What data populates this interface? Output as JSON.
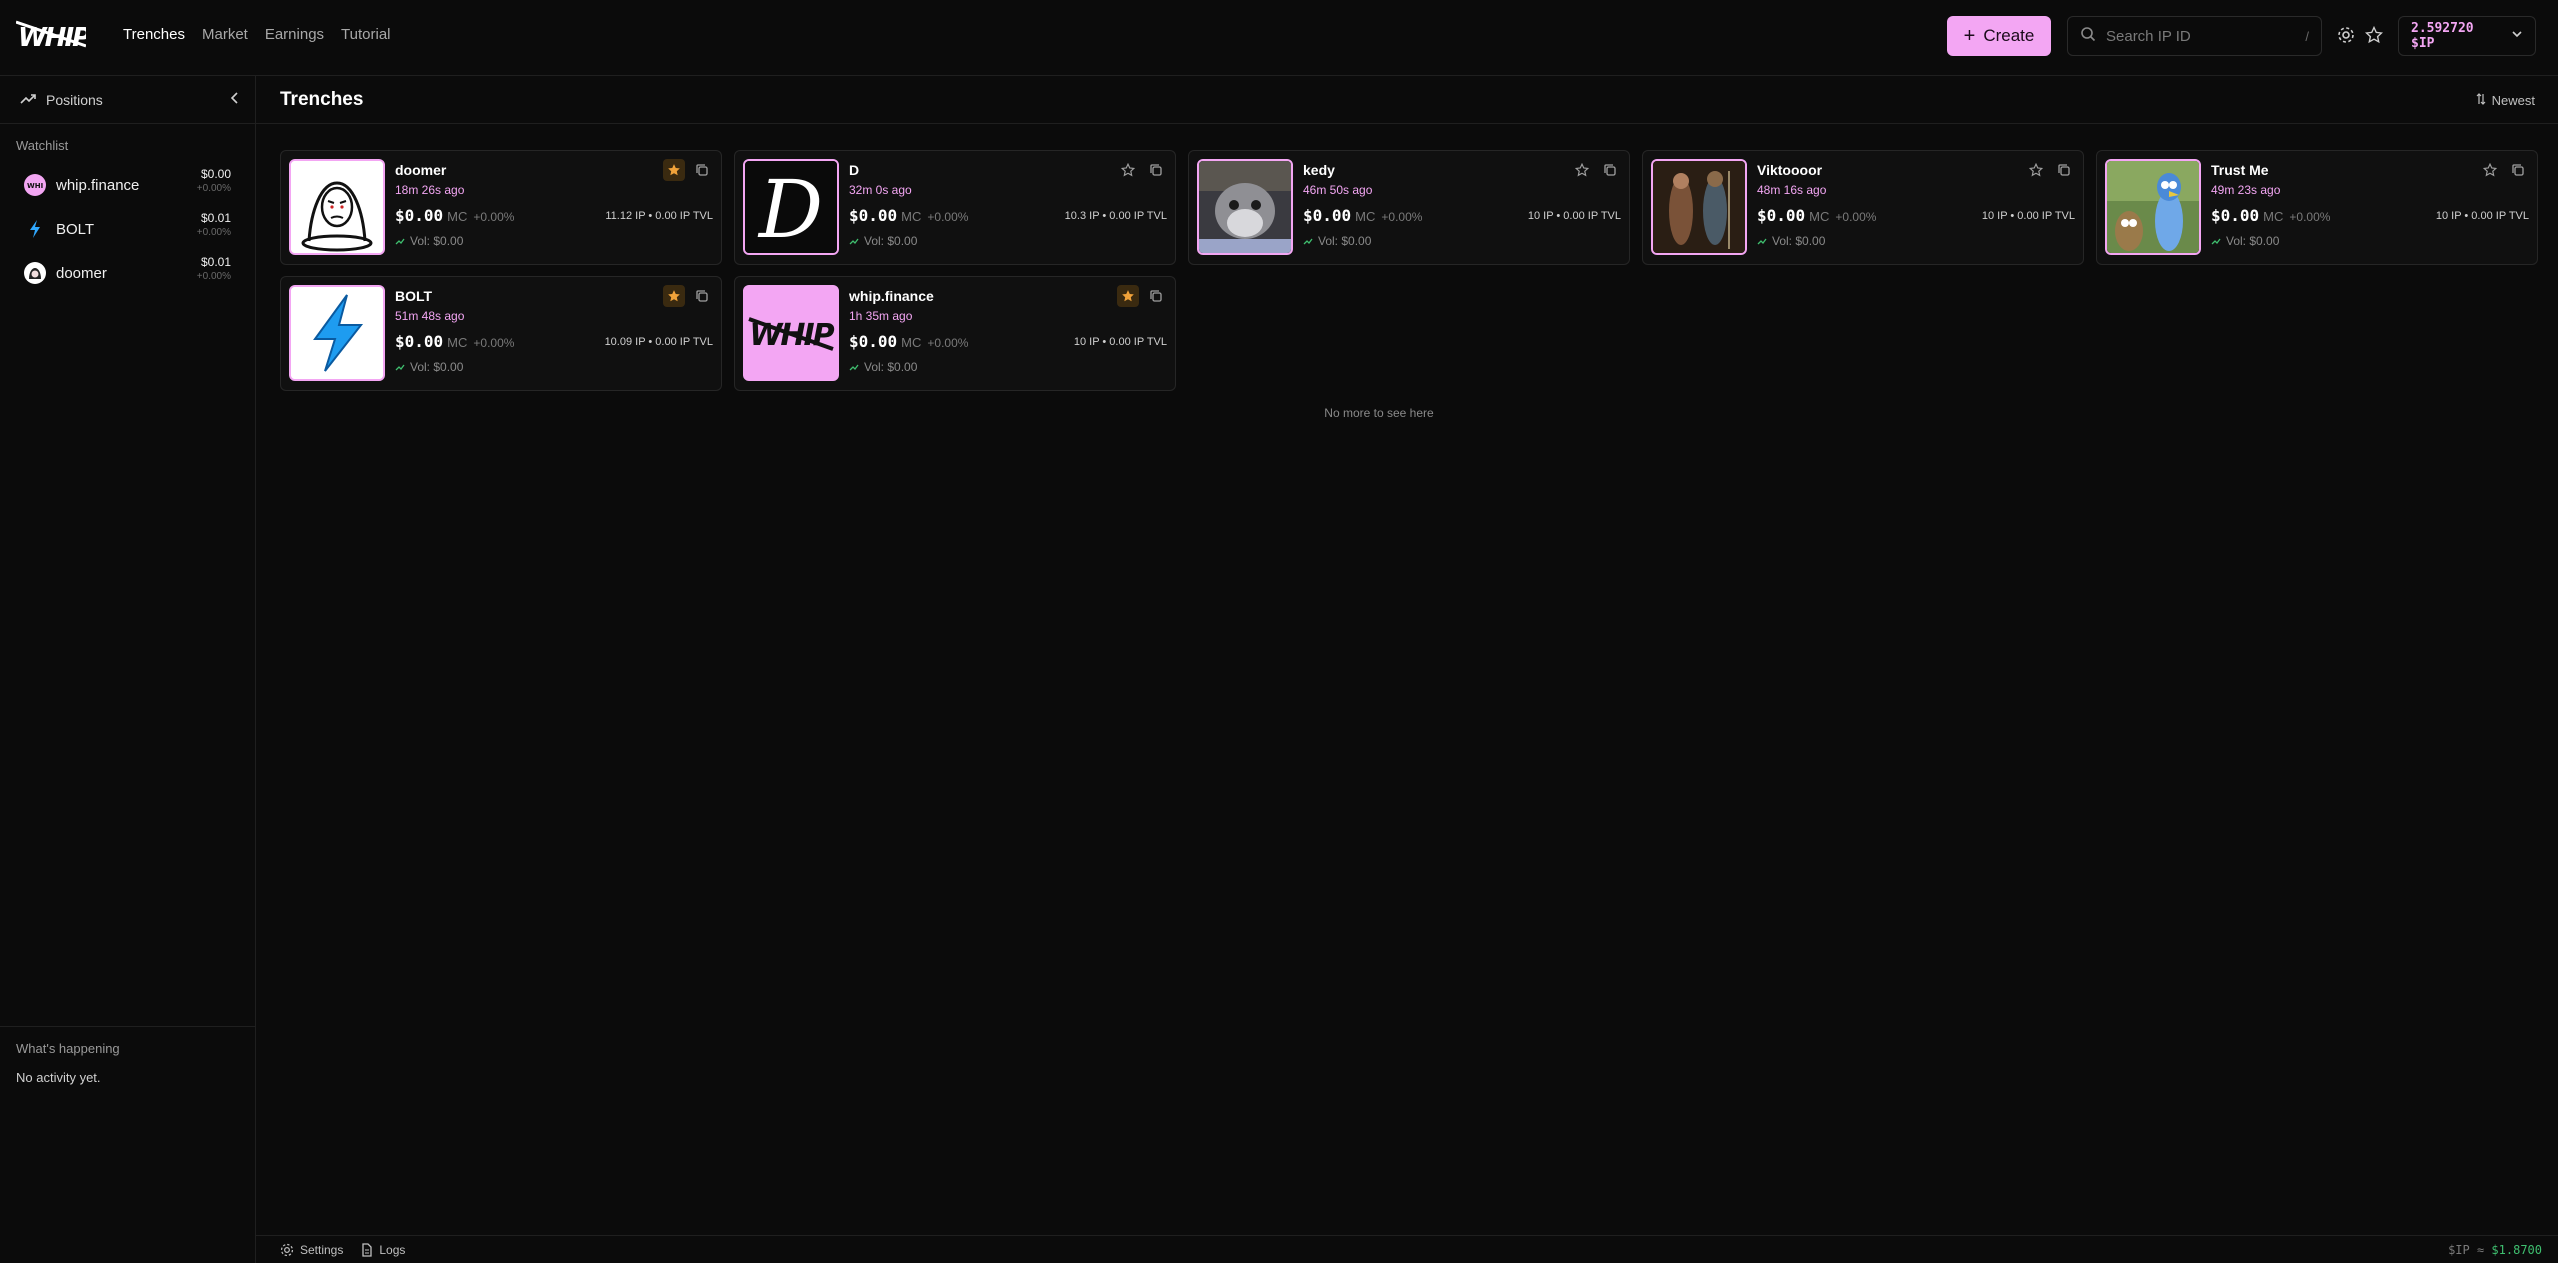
{
  "header": {
    "logo_text": "WHIP",
    "nav": [
      "Trenches",
      "Market",
      "Earnings",
      "Tutorial"
    ],
    "active_nav": "Trenches",
    "create_label": "Create",
    "search_placeholder": "Search IP ID",
    "search_shortcut": "/",
    "wallet_balance": "2.592720 $IP"
  },
  "sidebar": {
    "positions_label": "Positions",
    "watchlist_title": "Watchlist",
    "watchlist": [
      {
        "name": "whip.finance",
        "price": "$0.00",
        "change": "+0.00%"
      },
      {
        "name": "BOLT",
        "price": "$0.01",
        "change": "+0.00%"
      },
      {
        "name": "doomer",
        "price": "$0.01",
        "change": "+0.00%"
      }
    ],
    "happening_title": "What's happening",
    "happening_text": "No activity yet."
  },
  "main": {
    "title": "Trenches",
    "sort_label": "Newest",
    "empty_text": "No more to see here",
    "cards": [
      {
        "name": "doomer",
        "age": "18m 26s ago",
        "price": "$0.00",
        "mc": "MC",
        "change": "+0.00%",
        "tvl": "11.12 IP • 0.00 IP TVL",
        "vol": "Vol: $0.00",
        "starred": true
      },
      {
        "name": "D",
        "age": "32m 0s ago",
        "price": "$0.00",
        "mc": "MC",
        "change": "+0.00%",
        "tvl": "10.3 IP • 0.00 IP TVL",
        "vol": "Vol: $0.00",
        "starred": false
      },
      {
        "name": "kedy",
        "age": "46m 50s ago",
        "price": "$0.00",
        "mc": "MC",
        "change": "+0.00%",
        "tvl": "10 IP • 0.00 IP TVL",
        "vol": "Vol: $0.00",
        "starred": false
      },
      {
        "name": "Viktoooor",
        "age": "48m 16s ago",
        "price": "$0.00",
        "mc": "MC",
        "change": "+0.00%",
        "tvl": "10 IP • 0.00 IP TVL",
        "vol": "Vol: $0.00",
        "starred": false
      },
      {
        "name": "Trust Me",
        "age": "49m 23s ago",
        "price": "$0.00",
        "mc": "MC",
        "change": "+0.00%",
        "tvl": "10 IP • 0.00 IP TVL",
        "vol": "Vol: $0.00",
        "starred": false
      },
      {
        "name": "BOLT",
        "age": "51m 48s ago",
        "price": "$0.00",
        "mc": "MC",
        "change": "+0.00%",
        "tvl": "10.09 IP • 0.00 IP TVL",
        "vol": "Vol: $0.00",
        "starred": true
      },
      {
        "name": "whip.finance",
        "age": "1h 35m ago",
        "price": "$0.00",
        "mc": "MC",
        "change": "+0.00%",
        "tvl": "10 IP • 0.00 IP TVL",
        "vol": "Vol: $0.00",
        "starred": true
      }
    ]
  },
  "footer": {
    "settings_label": "Settings",
    "logs_label": "Logs",
    "rate_prefix": "$IP ≈",
    "rate_value": "$1.8700"
  },
  "colors": {
    "accent": "#f3a6f3",
    "star": "#f0a23a",
    "positive": "#3fbf6f"
  }
}
